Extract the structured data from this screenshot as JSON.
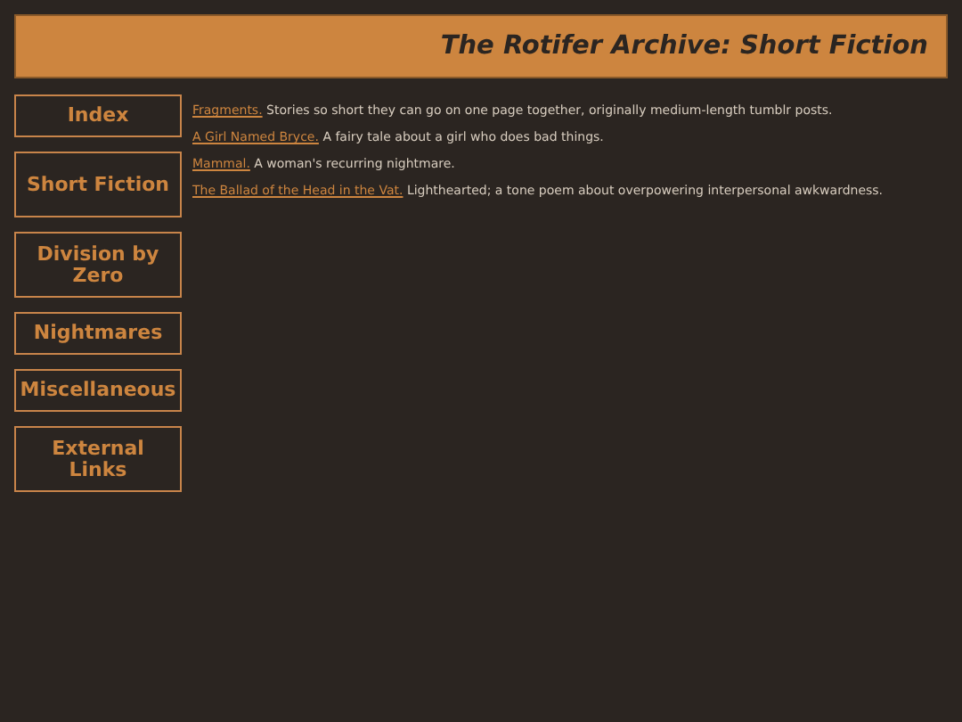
{
  "header": {
    "title": "The Rotifer Archive: Short Fiction"
  },
  "nav": [
    {
      "label": "Index"
    },
    {
      "label": "Short Fiction"
    },
    {
      "label": "Division by Zero"
    },
    {
      "label": "Nightmares"
    },
    {
      "label": "Miscellaneous"
    },
    {
      "label": "External Links"
    }
  ],
  "entries": [
    {
      "link": "Fragments.",
      "description": "Stories so short they can go on one page together, originally medium-length tumblr posts."
    },
    {
      "link": "A Girl Named Bryce.",
      "description": "A fairy tale about a girl who does bad things."
    },
    {
      "link": "Mammal.",
      "description": "A woman's recurring nightmare."
    },
    {
      "link": "The Ballad of the Head in the Vat.",
      "description": "Lighthearted; a tone poem about overpowering interpersonal awkwardness."
    }
  ]
}
